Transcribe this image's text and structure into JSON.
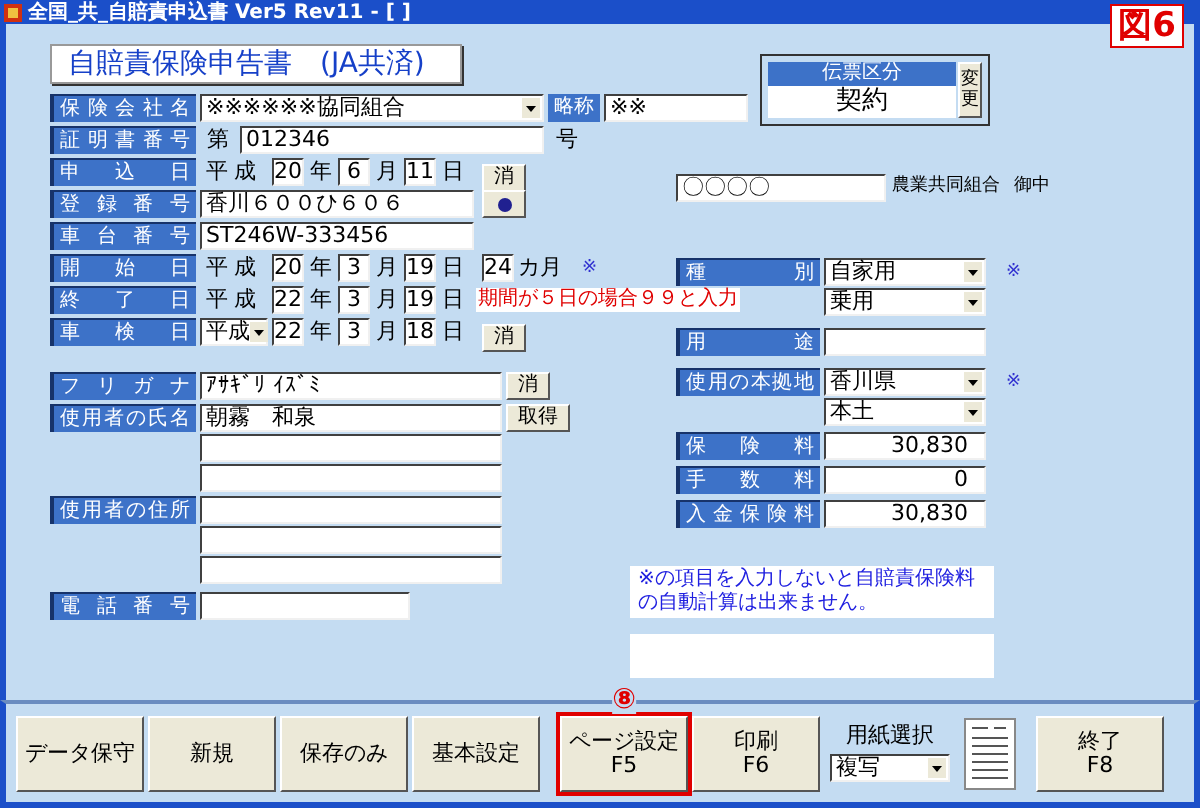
{
  "window": {
    "title": "全国_共_自賠責申込書 Ver5 Rev11 - [ ]"
  },
  "figure_label": "図6",
  "form_title": "自賠責保険申告書　(JA共済)",
  "company": {
    "label": "保険会社名",
    "value": "※※※※※※協同組合",
    "abbr_label": "略称",
    "abbr_value": "※※"
  },
  "certificate": {
    "label": "証明書番号",
    "prefix": "第",
    "value": "012346",
    "suffix": "号"
  },
  "rows": [
    {
      "kind": "date",
      "label": "申込日",
      "era": "平成",
      "era_select": false,
      "year": "20",
      "month": "6",
      "day": "11",
      "units": [
        "年",
        "月",
        "日"
      ],
      "button": "消"
    },
    {
      "kind": "text",
      "label": "登録番号",
      "value": "香川６００ひ６０６",
      "dot_button": true
    },
    {
      "kind": "text",
      "label": "車台番号",
      "value": "ST246W-333456",
      "dot_button": false
    },
    {
      "kind": "date",
      "label": "開始日",
      "era": "平成",
      "era_select": false,
      "year": "20",
      "month": "3",
      "day": "19",
      "units": [
        "年",
        "月",
        "日"
      ],
      "months": "24",
      "months_unit": "カ月",
      "mark": "※"
    },
    {
      "kind": "date",
      "label": "終了日",
      "era": "平成",
      "era_select": false,
      "year": "22",
      "month": "3",
      "day": "19",
      "units": [
        "年",
        "月",
        "日"
      ],
      "note": "期間が５日の場合９９と入力"
    },
    {
      "kind": "date",
      "label": "車検日",
      "era": "平成",
      "era_select": true,
      "year": "22",
      "month": "3",
      "day": "18",
      "units": [
        "年",
        "月",
        "日"
      ],
      "button": "消"
    }
  ],
  "furigana": {
    "label": "フリガナ",
    "value": "ｱｻｷﾞﾘ ｲｽﾞﾐ",
    "button": "消"
  },
  "user_name": {
    "label": "使用者の氏名",
    "value": "朝霧　和泉",
    "button": "取得"
  },
  "user_address": {
    "label": "使用者の住所"
  },
  "phone": {
    "label": "電話番号"
  },
  "slip_type": {
    "header": "伝票区分",
    "value": "契約",
    "button": "変更"
  },
  "addressee": {
    "value": "〇〇〇〇",
    "org": "農業共同組合",
    "honorific": "御中"
  },
  "right_rows": [
    {
      "kind": "select",
      "label": "種別",
      "value": "自家用",
      "mark": "※"
    },
    {
      "kind": "select",
      "value": "乗用"
    },
    {
      "kind": "text",
      "label": "用途"
    },
    {
      "kind": "select",
      "label": "使用の本拠地",
      "value": "香川県",
      "mark": "※"
    },
    {
      "kind": "select",
      "value": "本土"
    },
    {
      "kind": "amount",
      "label": "保険料",
      "value": "30,830"
    },
    {
      "kind": "amount",
      "label": "手数料",
      "value": "0"
    },
    {
      "kind": "amount",
      "label": "入金保険料",
      "value": "30,830"
    }
  ],
  "note": "※の項目を入力しないと自賠責保険料の自動計算は出来ません。",
  "toolbar": [
    {
      "kind": "button",
      "label": "データ保守"
    },
    {
      "kind": "button",
      "label": "新規"
    },
    {
      "kind": "button",
      "label": "保存のみ"
    },
    {
      "kind": "button",
      "label": "基本設定"
    },
    {
      "kind": "button",
      "label": "ページ設定",
      "key": "F5",
      "callout": "⑧"
    },
    {
      "kind": "button",
      "label": "印刷",
      "key": "F6"
    },
    {
      "kind": "paper",
      "label": "用紙選択",
      "value": "複写"
    },
    {
      "kind": "preview"
    },
    {
      "kind": "button",
      "label": "終了",
      "key": "F8"
    }
  ]
}
